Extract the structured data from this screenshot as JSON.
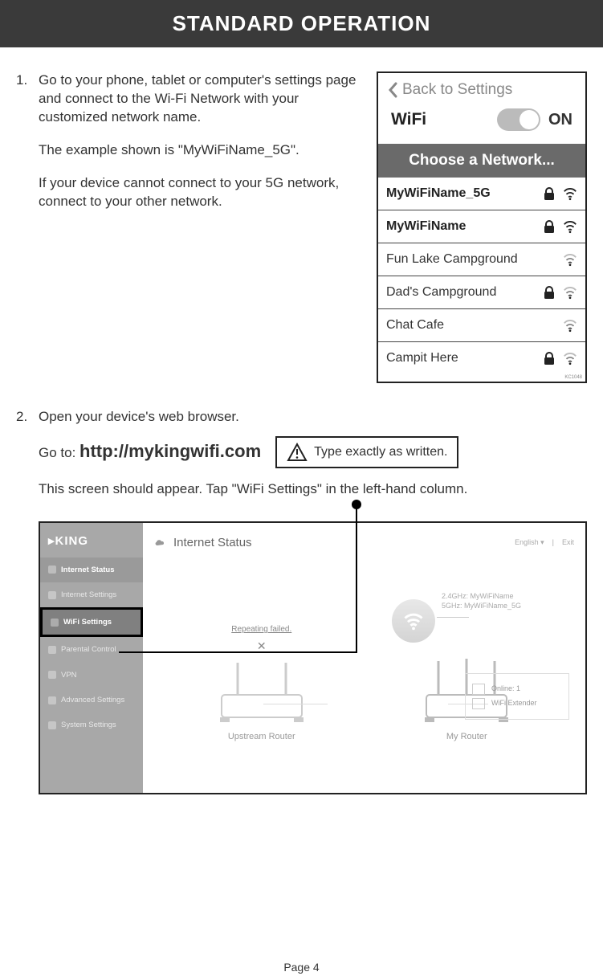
{
  "header": {
    "title": "STANDARD OPERATION"
  },
  "step1": {
    "number": "1.",
    "p1": "Go to your phone, tablet or computer's settings page and connect to the Wi-Fi Network with your customized network name.",
    "p2": "The example shown is \"MyWiFiName_5G\".",
    "p3": "If your device cannot connect to your 5G network, connect to your other network."
  },
  "wifi_panel": {
    "back_label": "Back to Settings",
    "wifi_label": "WiFi",
    "on_label": "ON",
    "choose_label": "Choose a Network...",
    "attribution": "KC1048",
    "networks": [
      {
        "name": "MyWiFiName_5G",
        "locked": true,
        "bold": true
      },
      {
        "name": "MyWiFiName",
        "locked": true,
        "bold": true
      },
      {
        "name": "Fun Lake Campground",
        "locked": false,
        "bold": false
      },
      {
        "name": "Dad's Campground",
        "locked": true,
        "bold": false
      },
      {
        "name": "Chat Cafe",
        "locked": false,
        "bold": false
      },
      {
        "name": "Campit Here",
        "locked": true,
        "bold": false
      }
    ]
  },
  "step2": {
    "number": "2.",
    "p1": "Open your device's web browser.",
    "goto_prefix": "Go to: ",
    "url": "http://mykingwifi.com",
    "warning": "Type exactly as written.",
    "p2": "This screen should appear.  Tap \"WiFi Settings\" in the left-hand column."
  },
  "dashboard": {
    "brand": "▸KING",
    "title": "Internet Status",
    "lang": "English",
    "exit": "Exit",
    "sidebar": [
      {
        "label": "Internet Status",
        "key": "internet-status",
        "state": "active"
      },
      {
        "label": "Internet Settings",
        "key": "internet-settings",
        "state": ""
      },
      {
        "label": "WiFi Settings",
        "key": "wifi-settings",
        "state": "highlight"
      },
      {
        "label": "Parental Control",
        "key": "parental-control",
        "state": ""
      },
      {
        "label": "VPN",
        "key": "vpn",
        "state": ""
      },
      {
        "label": "Advanced Settings",
        "key": "advanced-settings",
        "state": ""
      },
      {
        "label": "System Settings",
        "key": "system-settings",
        "state": ""
      }
    ],
    "ssid_24": "2.4GHz: MyWiFiName",
    "ssid_5": "5GHz: MyWiFiName_5G",
    "repeating": "Repeating failed.",
    "upstream_label": "Upstream Router",
    "myrouter_label": "My Router",
    "online_label": "Online:  1",
    "extender_label": "WiFi Extender"
  },
  "page_number": "Page 4"
}
